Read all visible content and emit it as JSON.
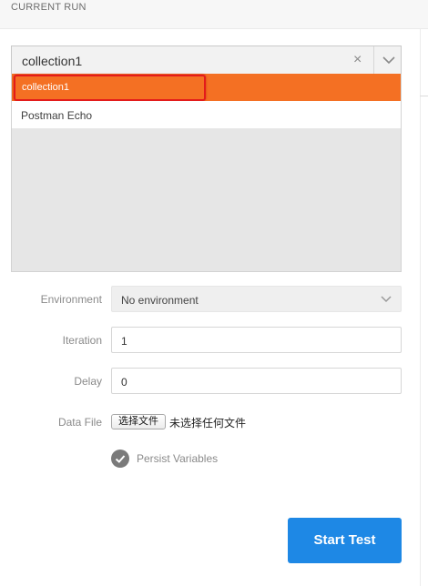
{
  "header": {
    "title": "CURRENT RUN"
  },
  "collection_select": {
    "value": "collection1",
    "clear_glyph": "×",
    "options": [
      {
        "label": "collection1",
        "selected": true
      },
      {
        "label": "Postman Echo",
        "selected": false
      }
    ]
  },
  "form": {
    "environment": {
      "label": "Environment",
      "value": "No environment"
    },
    "iteration": {
      "label": "Iteration",
      "value": "1"
    },
    "delay": {
      "label": "Delay",
      "value": "0"
    },
    "data_file": {
      "label": "Data File",
      "button_label": "选择文件",
      "status_text": "未选择任何文件"
    },
    "persist": {
      "label": "Persist Variables",
      "checked": true
    }
  },
  "actions": {
    "start_label": "Start Test"
  },
  "colors": {
    "accent_orange": "#f47023",
    "primary_blue": "#1e88e5",
    "annotation_red": "#e31b1b"
  },
  "icons": {
    "clear": "close-icon",
    "dropdown": "chevron-down-icon",
    "check": "checkmark-circle-icon"
  }
}
